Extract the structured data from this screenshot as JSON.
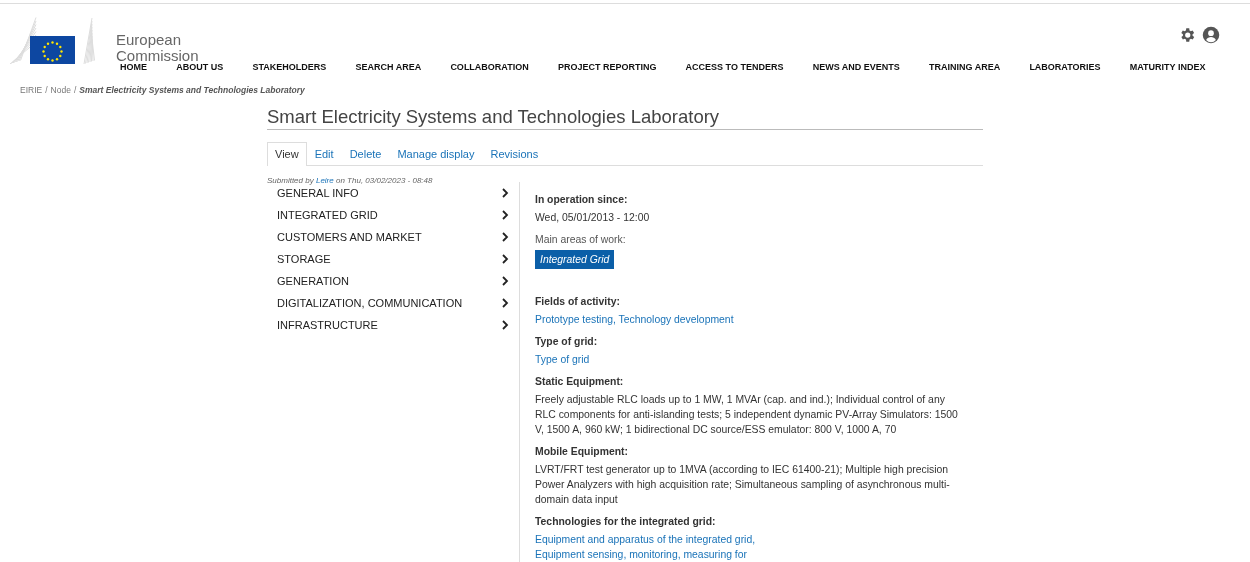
{
  "header": {
    "logo_text": [
      "European",
      "Commission"
    ],
    "nav": [
      "HOME",
      "ABOUT US",
      "STAKEHOLDERS",
      "SEARCH AREA",
      "COLLABORATION",
      "PROJECT REPORTING",
      "ACCESS TO TENDERS",
      "NEWS AND EVENTS",
      "TRAINING AREA",
      "LABORATORIES",
      "MATURITY INDEX"
    ]
  },
  "breadcrumb_separator": "/",
  "breadcrumb": [
    {
      "label": "EIRIE",
      "kind": "link"
    },
    {
      "label": "Node",
      "kind": "link"
    },
    {
      "label": "Smart Electricity Systems and Technologies Laboratory",
      "kind": "current"
    }
  ],
  "page_title": "Smart Electricity Systems and Technologies Laboratory",
  "tabs": [
    {
      "label": "View",
      "selected": true
    },
    {
      "label": "Edit",
      "selected": false
    },
    {
      "label": "Delete",
      "selected": false
    },
    {
      "label": "Manage display",
      "selected": false
    },
    {
      "label": "Revisions",
      "selected": false
    }
  ],
  "submitted": {
    "prefix": "Submitted by",
    "author": "Leire",
    "suffix": "on Thu, 03/02/2023 - 08:48"
  },
  "sections": [
    "GENERAL INFO",
    "INTEGRATED GRID",
    "CUSTOMERS AND MARKET",
    "STORAGE",
    "GENERATION",
    "DIGITALIZATION, COMMUNICATION",
    "INFRASTRUCTURE"
  ],
  "fields": [
    {
      "label": "In operation since:",
      "kind": "text",
      "value": "Wed, 05/01/2013 - 12:00"
    },
    {
      "label": "Main areas of work:",
      "kind": "tag",
      "value": "Integrated Grid"
    },
    {
      "label": "Fields of activity:",
      "kind": "links",
      "separator": ",",
      "values": [
        "Prototype testing",
        "Technology development"
      ]
    },
    {
      "label": "Type of grid:",
      "kind": "links",
      "values": [
        "Type of grid"
      ]
    },
    {
      "label": "Static Equipment:",
      "kind": "text",
      "value": "Freely adjustable RLC loads up to 1 MW, 1 MVAr (cap. and ind.); Individual control of any RLC components for anti-islanding tests; 5 independent dynamic PV-Array Simulators: 1500 V, 1500 A, 960 kW; 1 bidirectional DC source/ESS emulator: 800 V, 1000 A, 70"
    },
    {
      "label": "Mobile Equipment:",
      "kind": "text",
      "value": "LVRT/FRT test generator up to 1MVA (according to IEC 61400-21); Multiple high precision Power Analyzers with high acquisition rate; Simultaneous sampling of asynchronous multi-domain data input"
    },
    {
      "label": "Technologies for the integrated grid:",
      "kind": "links",
      "separator": ",",
      "values": [
        "Equipment and apparatus of the integrated grid",
        "Equipment sensing, monitoring, measuring for"
      ]
    }
  ]
}
